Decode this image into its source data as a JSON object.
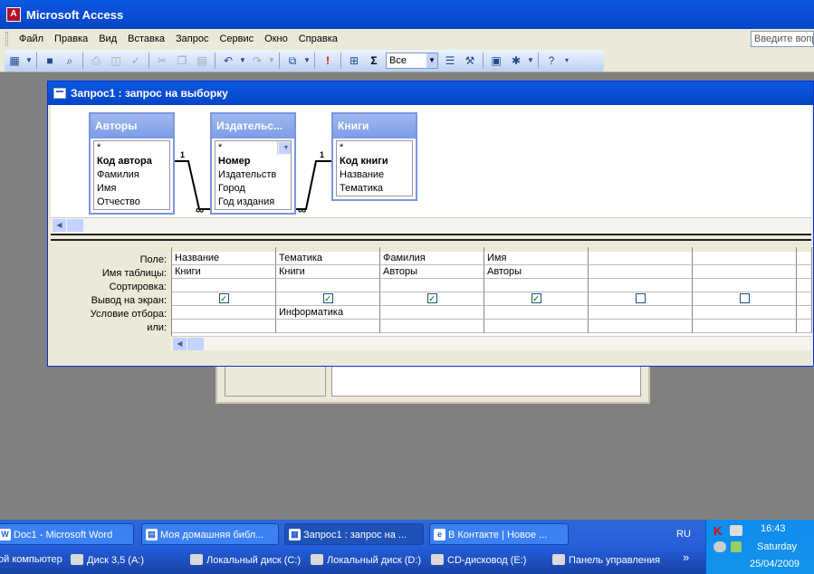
{
  "app": {
    "title": "Microsoft Access"
  },
  "menu": {
    "items": [
      "Файл",
      "Правка",
      "Вид",
      "Вставка",
      "Запрос",
      "Сервис",
      "Окно",
      "Справка"
    ],
    "help_placeholder": "Введите вопрос"
  },
  "toolbar": {
    "view_select": "Все"
  },
  "query_window": {
    "title": "Запрос1 : запрос на выборку",
    "tables": [
      {
        "name": "Авторы",
        "fields": [
          "*",
          "Код автора",
          "Фамилия",
          "Имя",
          "Отчество"
        ]
      },
      {
        "name": "Издательс...",
        "fields": [
          "*",
          "Номер",
          "Издательств",
          "Город",
          "Год издания"
        ]
      },
      {
        "name": "Книги",
        "fields": [
          "*",
          "Код книги",
          "Название",
          "Тематика"
        ]
      }
    ],
    "relations": {
      "one": "1",
      "many": "∞"
    },
    "row_labels": [
      "Поле:",
      "Имя таблицы:",
      "Сортировка:",
      "Вывод на экран:",
      "Условие отбора:",
      "или:"
    ],
    "columns": [
      {
        "field": "Название",
        "table": "Книги",
        "show": true,
        "criteria": ""
      },
      {
        "field": "Тематика",
        "table": "Книги",
        "show": true,
        "criteria": "Информатика"
      },
      {
        "field": "Фамилия",
        "table": "Авторы",
        "show": true,
        "criteria": ""
      },
      {
        "field": "Имя",
        "table": "Авторы",
        "show": true,
        "criteria": ""
      },
      {
        "field": "",
        "table": "",
        "show": false,
        "criteria": ""
      },
      {
        "field": "",
        "table": "",
        "show": false,
        "criteria": ""
      }
    ]
  },
  "taskbar": {
    "tasks": [
      "Doc1 - Microsoft Word",
      "Моя домашняя библ...",
      "Запрос1 : запрос на ...",
      "В Контакте | Новое ..."
    ],
    "language": "RU",
    "time": "16:43",
    "day": "Saturday",
    "date": "25/04/2009",
    "quick": [
      "ой компьютер",
      "Диск 3,5 (A:)",
      "Локальный диск (C:)",
      "Локальный диск (D:)",
      "CD-дисковод (E:)",
      "Панель управления"
    ],
    "chevron": "»"
  },
  "colors": {
    "xp_blue": "#0b4fd8",
    "face": "#ece9d8",
    "desktop": "#808080"
  }
}
